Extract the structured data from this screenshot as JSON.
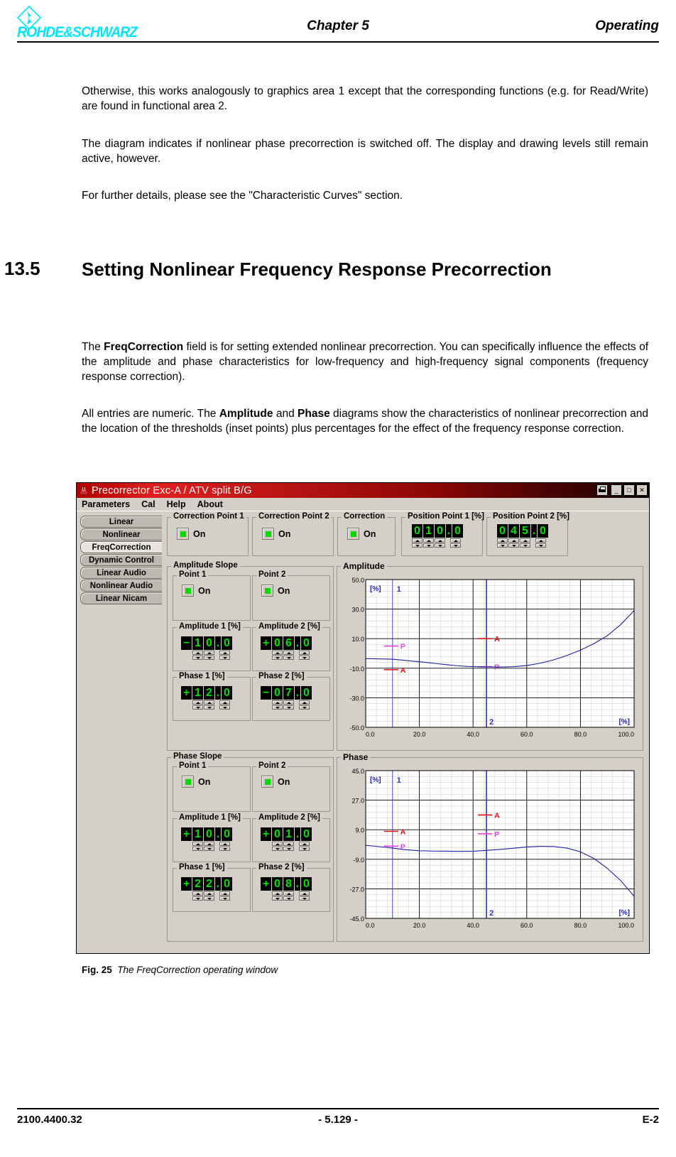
{
  "header": {
    "brand": "ROHDE&SCHWARZ",
    "chapter": "Chapter 5",
    "right": "Operating"
  },
  "paragraphs": {
    "p1": "Otherwise, this works analogously to graphics area 1 except that the corresponding functions (e.g. for Read/Write) are found in functional area 2.",
    "p2": "The diagram indicates if nonlinear phase precorrection is switched off. The display and drawing levels still remain active, however.",
    "p3": "For further details, please see the \"Characteristic Curves\" section."
  },
  "heading": {
    "number": "13.5",
    "title": "Setting Nonlinear Frequency Response Precorrection"
  },
  "para4": {
    "a": "The ",
    "b": "FreqCorrection",
    "c": " field is for setting extended nonlinear precorrection. You can specifically influence the effects of the amplitude and phase characteristics for low-frequency and high-frequency signal components (frequency response correction)."
  },
  "para5": {
    "a": "All entries are numeric. The ",
    "b": "Amplitude",
    "c": " and ",
    "d": "Phase",
    "e": " diagrams show the characteristics of nonlinear precorrection and the location of the thresholds (inset points) plus percentages for the effect of the frequency response correction."
  },
  "window": {
    "title": "Precorrector Exc-A /  ATV split B/G",
    "title_icon": "application-icon",
    "buttons": {
      "print": "print-icon",
      "minimize": "_",
      "maximize": "□",
      "close": "✕"
    },
    "menu": [
      "Parameters",
      "Cal",
      "Help",
      "About"
    ],
    "sidebar": {
      "items": [
        {
          "label": "Linear",
          "selected": false
        },
        {
          "label": "Nonlinear",
          "selected": false
        },
        {
          "label": "FreqCorrection",
          "selected": true
        },
        {
          "label": "Dynamic Control",
          "selected": false
        },
        {
          "label": "Linear Audio",
          "selected": false
        },
        {
          "label": "Nonlinear Audio",
          "selected": false
        },
        {
          "label": "Linear Nicam",
          "selected": false
        }
      ]
    },
    "top_groups": [
      {
        "legend": "Correction Point 1",
        "toggle": "On",
        "led": "#00d800"
      },
      {
        "legend": "Correction Point 2",
        "toggle": "On",
        "led": "#00d800"
      },
      {
        "legend": "Correction",
        "toggle": "On",
        "led": "#00d800"
      }
    ],
    "position_points": [
      {
        "legend": "Position Point 1 [%]",
        "digits": [
          "0",
          "1",
          "0",
          ".",
          "0"
        ]
      },
      {
        "legend": "Position Point 2 [%]",
        "digits": [
          "0",
          "4",
          "5",
          ".",
          "0"
        ]
      }
    ],
    "amplitude_slope": {
      "legend": "Amplitude Slope",
      "points": [
        {
          "legend": "Point 1",
          "toggle": "On"
        },
        {
          "legend": "Point 2",
          "toggle": "On"
        }
      ],
      "fields": [
        {
          "legend": "Amplitude 1 [%]",
          "digits": [
            "−",
            "1",
            "0",
            ".",
            "0"
          ]
        },
        {
          "legend": "Amplitude 2 [%]",
          "digits": [
            "+",
            "0",
            "6",
            ".",
            "0"
          ]
        },
        {
          "legend": "Phase 1 [%]",
          "digits": [
            "+",
            "1",
            "2",
            ".",
            "0"
          ]
        },
        {
          "legend": "Phase 2 [%]",
          "digits": [
            "−",
            "0",
            "7",
            ".",
            "0"
          ]
        }
      ]
    },
    "phase_slope": {
      "legend": "Phase Slope",
      "points": [
        {
          "legend": "Point 1",
          "toggle": "On"
        },
        {
          "legend": "Point 2",
          "toggle": "On"
        }
      ],
      "fields": [
        {
          "legend": "Amplitude 1 [%]",
          "digits": [
            "+",
            "1",
            "0",
            ".",
            "0"
          ]
        },
        {
          "legend": "Amplitude 2 [%]",
          "digits": [
            "+",
            "0",
            "1",
            ".",
            "0"
          ]
        },
        {
          "legend": "Phase 1 [%]",
          "digits": [
            "+",
            "2",
            "2",
            ".",
            "0"
          ]
        },
        {
          "legend": "Phase 2 [%]",
          "digits": [
            "+",
            "0",
            "8",
            ".",
            "0"
          ]
        }
      ]
    }
  },
  "chart_data": [
    {
      "type": "line",
      "title": "Amplitude",
      "xlabel": "[%]",
      "ylabel": "[%]",
      "xlim": [
        0.0,
        100.0
      ],
      "ylim": [
        -50.0,
        50.0
      ],
      "xticks": [
        "0.0",
        "20.0",
        "40.0",
        "60.0",
        "80.0",
        "100.0"
      ],
      "yticks": [
        "50.0",
        "30.0",
        "10.0",
        "-10.0",
        "-30.0",
        "-50.0"
      ],
      "grid": true,
      "markers": [
        {
          "label": "1",
          "x": 10.0,
          "color": "#3333bb"
        },
        {
          "label": "2",
          "x": 45.0,
          "color": "#3333bb"
        }
      ],
      "annotations": [
        {
          "label": "P",
          "x": 10.0,
          "y": 5.0,
          "color": "#e040e0"
        },
        {
          "label": "A",
          "x": 10.0,
          "y": -11.0,
          "color": "#e01010"
        },
        {
          "label": "A",
          "x": 45.0,
          "y": 10.0,
          "color": "#e01010"
        },
        {
          "label": "P",
          "x": 45.0,
          "y": -9.0,
          "color": "#e040e0"
        }
      ],
      "series": [
        {
          "name": "amplitude-curve",
          "color": "#2020a0",
          "x": [
            0,
            5,
            10,
            14,
            18,
            22,
            26,
            30,
            34,
            38,
            42,
            46,
            50,
            55,
            60,
            65,
            70,
            75,
            80,
            85,
            90,
            95,
            100
          ],
          "y": [
            -3.5,
            -3.7,
            -3.9,
            -4.6,
            -5.3,
            -6.0,
            -6.8,
            -7.6,
            -8.3,
            -8.8,
            -9.0,
            -9.1,
            -9.2,
            -9.0,
            -8.2,
            -6.6,
            -4.4,
            -1.4,
            2.2,
            6.6,
            12.0,
            19.5,
            29.0
          ]
        }
      ]
    },
    {
      "type": "line",
      "title": "Phase",
      "xlabel": "[%]",
      "ylabel": "[%]",
      "xlim": [
        0.0,
        100.0
      ],
      "ylim": [
        -45.0,
        45.0
      ],
      "xticks": [
        "0.0",
        "20.0",
        "40.0",
        "60.0",
        "80.0",
        "100.0"
      ],
      "yticks": [
        "45.0",
        "27.0",
        "9.0",
        "-9.0",
        "-27.0",
        "-45.0"
      ],
      "grid": true,
      "markers": [
        {
          "label": "1",
          "x": 10.0,
          "color": "#3333bb"
        },
        {
          "label": "2",
          "x": 45.0,
          "color": "#3333bb"
        }
      ],
      "annotations": [
        {
          "label": "A",
          "x": 10.0,
          "y": 8.0,
          "color": "#e01010"
        },
        {
          "label": "P",
          "x": 10.0,
          "y": -1.0,
          "color": "#e040e0"
        },
        {
          "label": "A",
          "x": 45.0,
          "y": 18.0,
          "color": "#e01010"
        },
        {
          "label": "P",
          "x": 45.0,
          "y": 6.5,
          "color": "#e040e0"
        }
      ],
      "series": [
        {
          "name": "phase-curve",
          "color": "#2020a0",
          "x": [
            0,
            5,
            10,
            15,
            20,
            25,
            30,
            35,
            40,
            45,
            50,
            55,
            60,
            65,
            70,
            75,
            80,
            85,
            90,
            95,
            100
          ],
          "y": [
            -0.5,
            -1.3,
            -2.2,
            -3.2,
            -3.8,
            -4.0,
            -4.1,
            -4.2,
            -4.1,
            -3.6,
            -3.0,
            -2.3,
            -1.5,
            -1.1,
            -1.2,
            -2.2,
            -4.5,
            -8.5,
            -14.5,
            -22.0,
            -31.5
          ]
        }
      ]
    }
  ],
  "figure_caption": {
    "label": "Fig. 25",
    "text": "The FreqCorrection operating window"
  },
  "footer": {
    "left": "2100.4400.32",
    "center": "- 5.129 -",
    "right": "E-2"
  }
}
